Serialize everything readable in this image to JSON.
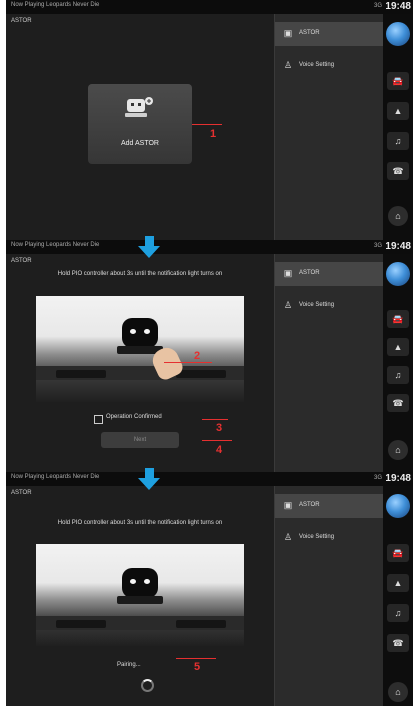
{
  "status_bar": {
    "notification": "Now Playing Leopards Never Die",
    "signal": "3G",
    "clock": "19:48"
  },
  "screens": [
    {
      "title": "ASTOR",
      "button_label": "Add ASTOR",
      "callout": "1"
    },
    {
      "title": "ASTOR",
      "instruction": "Hold PIO controller about 3s until the notification light turns on",
      "checkbox_label": "Operation Confirmed",
      "next_label": "Next",
      "callouts": [
        "2",
        "3",
        "4"
      ]
    },
    {
      "title": "ASTOR",
      "instruction": "Hold PIO controller about 3s until the notification light turns on",
      "pairing_label": "Pairing...",
      "callout": "5"
    }
  ],
  "menu": {
    "items": [
      {
        "label": "ASTOR",
        "icon": "device-icon",
        "active": true
      },
      {
        "label": "Voice Setting",
        "icon": "person-voice-icon",
        "active": false
      }
    ]
  },
  "dock": {
    "icons": [
      "globe-icon",
      "car-icon",
      "navigation-icon",
      "music-icon",
      "phone-icon",
      "home-icon"
    ],
    "glyphs": {
      "car": "🚘",
      "nav": "▲",
      "music": "♫",
      "phone": "☎",
      "home": "⌂"
    }
  },
  "colors": {
    "accent_red": "#e53030",
    "arrow_blue": "#1ea0e0",
    "background": "#1b1b1b"
  }
}
